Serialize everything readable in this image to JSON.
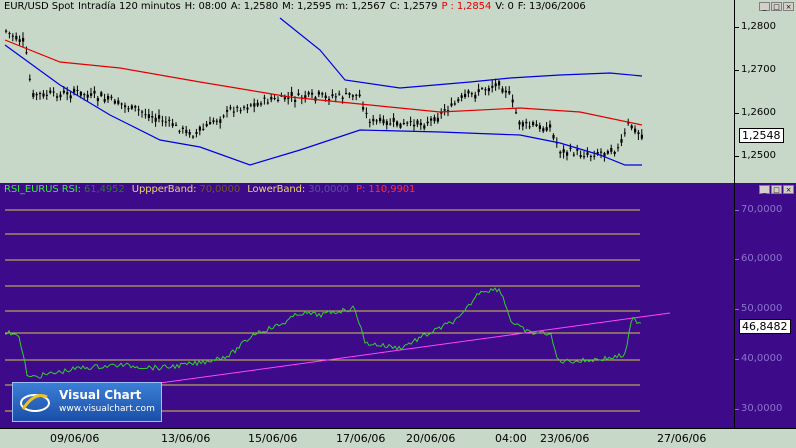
{
  "price_panel": {
    "symbol": "EUR/USD Spot",
    "interval": "Intradía 120 minutos",
    "H": {
      "label": "H:",
      "value": "08:00"
    },
    "A": {
      "label": "A:",
      "value": "1,2580"
    },
    "M": {
      "label": "M:",
      "value": "1,2595"
    },
    "m": {
      "label": "m:",
      "value": "1,2567"
    },
    "C": {
      "label": "C:",
      "value": "1,2579"
    },
    "P": {
      "label": "P :",
      "value": "1,2854"
    },
    "V": {
      "label": "V:",
      "value": "0"
    },
    "F": {
      "label": "F:",
      "value": "13/06/2006"
    },
    "ticks": [
      "1,2800",
      "1,2700",
      "1,2600",
      "1,2500"
    ],
    "last_value": "1,2548",
    "colors": {
      "bg": "#c8d8c8",
      "candles": "#000000",
      "ma": "#e00000",
      "bands": "#0000e0",
      "P": "#e00000"
    }
  },
  "rsi_panel": {
    "title": "RSI_EURUS",
    "rsi_label": "RSI:",
    "rsi_value": "61,4952",
    "upper_label": "UppperBand:",
    "upper_value": "70,0000",
    "lower_label": "LowerBand:",
    "lower_value": "30,0000",
    "p_label": "P:",
    "p_value": "110,9901",
    "ticks": [
      "70,0000",
      "60,0000",
      "50,0000",
      "40,0000",
      "30,0000"
    ],
    "last_value": "46,8482",
    "colors": {
      "bg": "#3d0a8a",
      "rsi": "#33cc33",
      "levels": "#d4c84a",
      "trend": "#ff44ff"
    }
  },
  "date_axis": {
    "labels": [
      "09/06/06",
      "13/06/06",
      "15/06/06",
      "17/06/06",
      "20/06/06",
      "04:00",
      "23/06/06",
      "27/06/06"
    ]
  },
  "logo": {
    "title": "Visual Chart",
    "url": "www.visualchart.com"
  },
  "window_buttons": {
    "minimize": "_",
    "restore": "□",
    "close": "×"
  }
}
